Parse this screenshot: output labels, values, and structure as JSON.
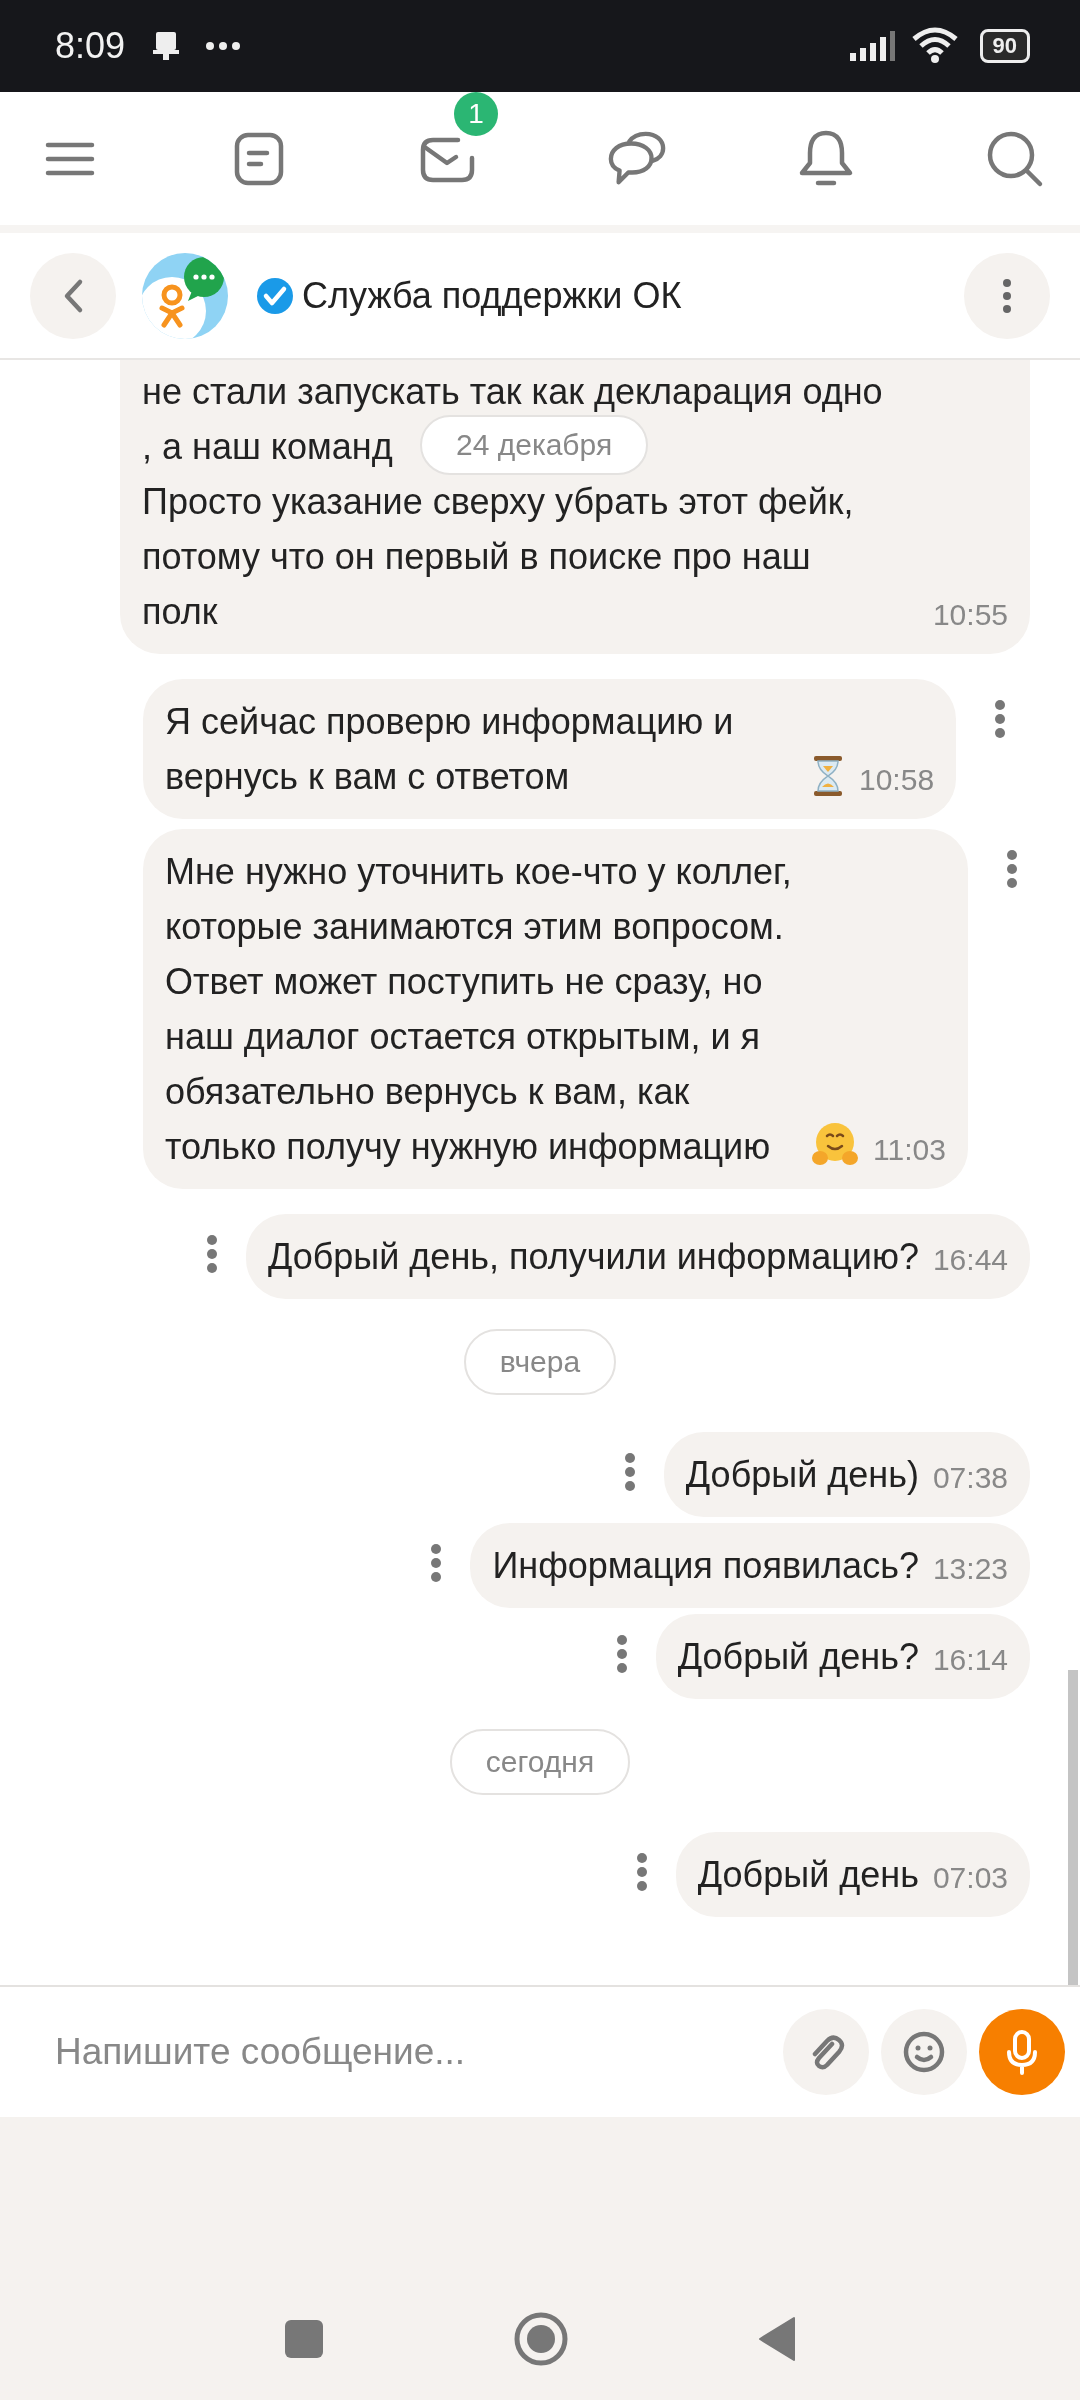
{
  "status_bar": {
    "time": "8:09",
    "battery": "90"
  },
  "top_nav": [
    {
      "kind": "menu"
    },
    {
      "kind": "feed"
    },
    {
      "kind": "mail",
      "badge": "1"
    },
    {
      "kind": "chats"
    },
    {
      "kind": "bell"
    },
    {
      "kind": "search"
    }
  ],
  "chat_header": {
    "title": "Служба поддержки ОК",
    "verified": true
  },
  "sticky_date": "24 декабря",
  "messages": [
    {
      "kind": "message",
      "outgoing": true,
      "has_menu": false,
      "text_parts": [
        "не стали запускать так как декларация одно",
        ", а наш команд",
        "Просто указание сверху убрать этот фейк,\nпотому что он первый в поиске про наш\nполк"
      ],
      "time": "10:55"
    },
    {
      "kind": "message",
      "outgoing": false,
      "has_menu": true,
      "text": "Я сейчас проверю информацию и вернусь к вам с ответом",
      "emoji": {
        "kind": "hourglass"
      },
      "time": "10:58"
    },
    {
      "kind": "message",
      "outgoing": false,
      "has_menu": true,
      "text": "Мне нужно уточнить кое-что у коллег, которые занимаются этим вопросом. Ответ может поступить не сразу, но наш диалог остается открытым, и я обязательно вернусь к вам, как только получу нужную информацию",
      "emoji": {
        "kind": "hug"
      },
      "time": "11:03"
    },
    {
      "kind": "message",
      "outgoing": true,
      "has_menu": true,
      "text": "Добрый день, получили информацию?",
      "time": "16:44"
    },
    {
      "kind": "date",
      "text": "вчера"
    },
    {
      "kind": "message",
      "outgoing": true,
      "has_menu": true,
      "text": "Добрый день)",
      "time": "07:38"
    },
    {
      "kind": "message",
      "outgoing": true,
      "has_menu": true,
      "text": "Информация появилась?",
      "time": "13:23"
    },
    {
      "kind": "message",
      "outgoing": true,
      "has_menu": true,
      "text": "Добрый день?",
      "time": "16:14"
    },
    {
      "kind": "date",
      "text": "сегодня"
    },
    {
      "kind": "message",
      "outgoing": true,
      "has_menu": true,
      "text": "Добрый день",
      "time": "07:03"
    }
  ],
  "composer": {
    "placeholder": "Напишите сообщение..."
  }
}
